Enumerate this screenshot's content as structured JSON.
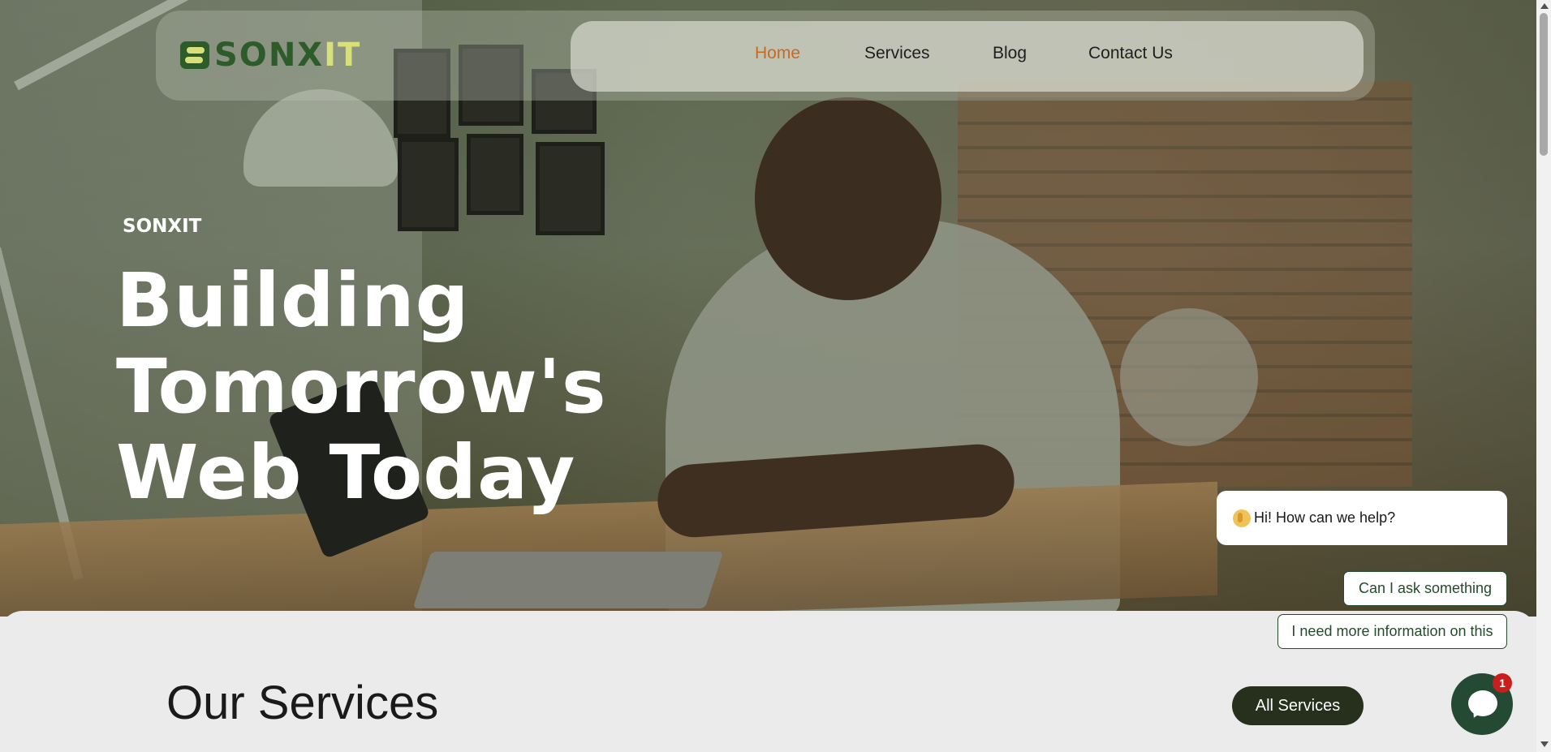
{
  "header": {
    "logo": {
      "part1": "SONX",
      "part2": "IT"
    },
    "nav": [
      {
        "label": "Home",
        "active": true
      },
      {
        "label": "Services"
      },
      {
        "label": "Blog"
      },
      {
        "label": "Contact Us"
      }
    ]
  },
  "hero": {
    "eyebrow": "SONXIT",
    "headline_line1": "Building Tomorrow's",
    "headline_line2": "Web Today"
  },
  "services": {
    "title": "Our Services",
    "all_button": "All Services"
  },
  "chat": {
    "greeting": "Hi! How can we help?",
    "quick_replies": [
      "Can I ask something",
      "I need more information on this"
    ],
    "unread_count": "1"
  },
  "colors": {
    "accent_active_nav": "#c76a22",
    "brand_dark_green": "#26301d",
    "logo_green": "#2e5b2a",
    "logo_yellow": "#d8e07a",
    "chat_green": "#254a34",
    "badge_red": "#c81e1e"
  },
  "icons": {
    "logo": "sonxit-logo-mark",
    "greeting": "waving-hand-icon",
    "launcher": "chat-bubble-icon"
  }
}
